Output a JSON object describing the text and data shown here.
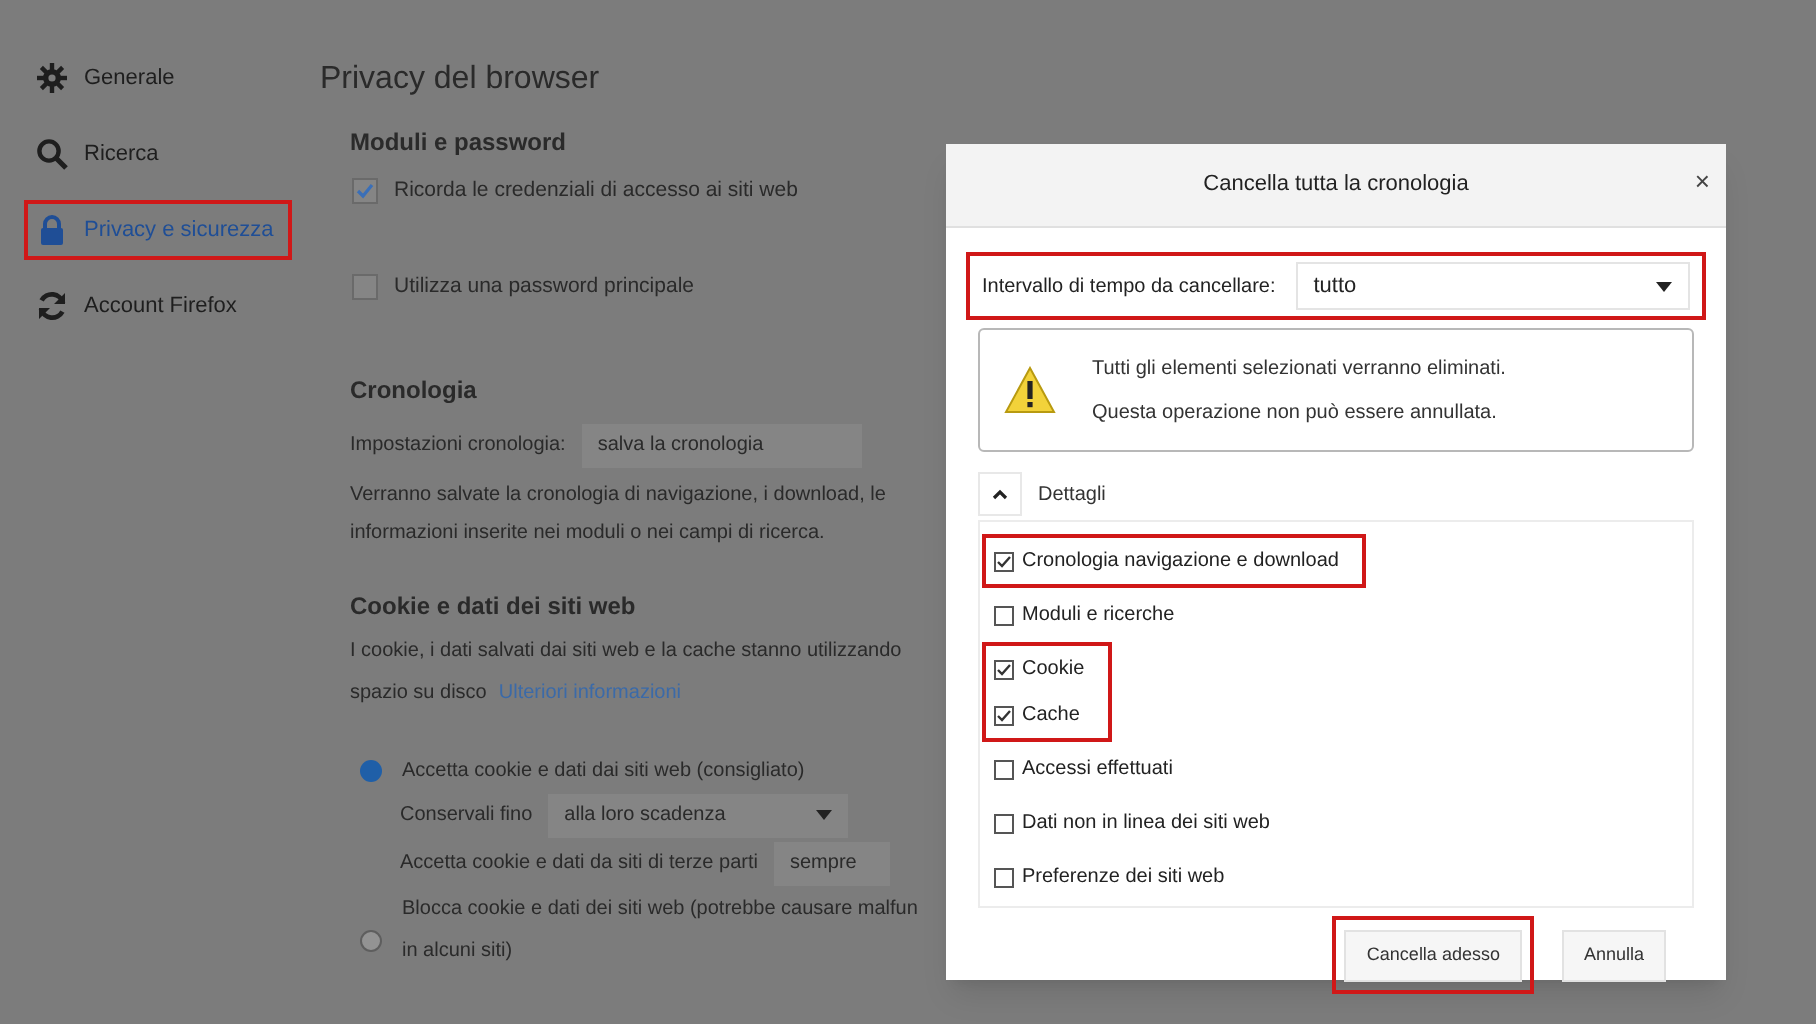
{
  "sidebar": {
    "items": [
      {
        "label": "Generale",
        "selected": false,
        "highlighted": false
      },
      {
        "label": "Ricerca",
        "selected": false,
        "highlighted": false
      },
      {
        "label": "Privacy e sicurezza",
        "selected": true,
        "highlighted": true
      },
      {
        "label": "Account Firefox",
        "selected": false,
        "highlighted": false
      }
    ]
  },
  "content": {
    "title": "Privacy del browser",
    "forms": {
      "heading": "Moduli e password",
      "options": [
        {
          "label": "Ricorda le credenziali di accesso ai siti web",
          "checked": true
        },
        {
          "label": "Utilizza una password principale",
          "checked": false
        }
      ]
    },
    "history": {
      "heading": "Cronologia",
      "setting_label": "Impostazioni cronologia:",
      "setting_value": "salva la cronologia",
      "description": "Verranno salvate la cronologia di navigazione, i download, le informazioni inserite nei moduli o nei campi di ricerca."
    },
    "cookies": {
      "heading": "Cookie e dati dei siti web",
      "description": "I cookie, i dati salvati dai siti web e la cache stanno utilizzando",
      "description_2": "spazio su disco",
      "link": "Ulteriori informazioni",
      "accept": {
        "label": "Accetta cookie e dati dai siti web (consigliato)",
        "selected": true
      },
      "keep_label": "Conservali fino",
      "keep_value": "alla loro scadenza",
      "third_party_label": "Accetta cookie e dati da siti di terze parti",
      "third_party_value": "sempre",
      "block": {
        "label": "Blocca cookie e dati dei siti web (potrebbe causare malfun",
        "label_2": "in alcuni siti)",
        "selected": false
      }
    }
  },
  "dialog": {
    "title": "Cancella tutta la cronologia",
    "close": "×",
    "interval_label": "Intervallo di tempo da cancellare:",
    "interval_value": "tutto",
    "interval_highlighted": true,
    "warning": [
      "Tutti gli elementi selezionati verranno eliminati.",
      "Questa operazione non può essere annullata."
    ],
    "details_label": "Dettagli",
    "details_expanded": true,
    "items": [
      {
        "label": "Cronologia navigazione e download",
        "checked": true,
        "highlighted": true
      },
      {
        "label": "Moduli e ricerche",
        "checked": false,
        "highlighted": false
      },
      {
        "label": "Cookie",
        "checked": true,
        "highlighted": true
      },
      {
        "label": "Cache",
        "checked": true,
        "highlighted": true
      },
      {
        "label": "Accessi effettuati",
        "checked": false,
        "highlighted": false
      },
      {
        "label": "Dati non in linea dei siti web",
        "checked": false,
        "highlighted": false
      },
      {
        "label": "Preferenze dei siti web",
        "checked": false,
        "highlighted": false
      }
    ],
    "buttons": [
      {
        "label": "Cancella adesso",
        "highlighted": true
      },
      {
        "label": "Annulla",
        "highlighted": false
      }
    ]
  }
}
